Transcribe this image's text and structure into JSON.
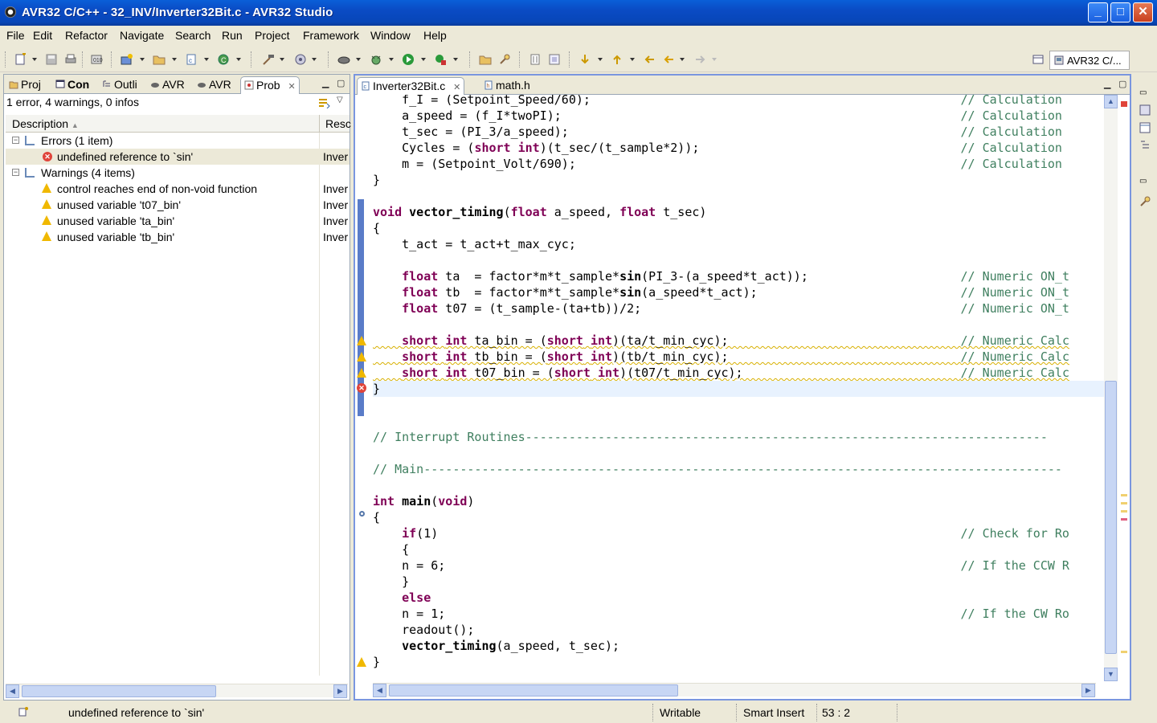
{
  "window": {
    "title": "AVR32 C/C++ - 32_INV/Inverter32Bit.c - AVR32 Studio",
    "min": "_",
    "max": "□",
    "close": "✕"
  },
  "menu": [
    "File",
    "Edit",
    "Refactor",
    "Navigate",
    "Search",
    "Run",
    "Project",
    "Framework",
    "Window",
    "Help"
  ],
  "perspective": "AVR32 C/...",
  "left_tabs": [
    {
      "label": "Proj",
      "icon": "project-explorer-icon"
    },
    {
      "label": "Con",
      "icon": "console-icon"
    },
    {
      "label": "Outli",
      "icon": "outline-icon"
    },
    {
      "label": "AVR",
      "icon": "avr-target-icon"
    },
    {
      "label": "AVR",
      "icon": "avr-target-icon"
    },
    {
      "label": "Prob",
      "icon": "problems-icon"
    }
  ],
  "problems": {
    "summary": "1 error, 4 warnings, 0 infos",
    "col_description": "Description",
    "col_resource": "Resc",
    "groups": [
      {
        "label": "Errors (1 item)",
        "items": [
          {
            "kind": "error",
            "text": "undefined reference to `sin'",
            "resource": "Inver"
          }
        ]
      },
      {
        "label": "Warnings (4 items)",
        "items": [
          {
            "kind": "warning",
            "text": "control reaches end of non-void function",
            "resource": "Inver"
          },
          {
            "kind": "warning",
            "text": "unused variable 't07_bin'",
            "resource": "Inver"
          },
          {
            "kind": "warning",
            "text": "unused variable 'ta_bin'",
            "resource": "Inver"
          },
          {
            "kind": "warning",
            "text": "unused variable 'tb_bin'",
            "resource": "Inver"
          }
        ]
      }
    ]
  },
  "editor_tabs": [
    {
      "label": "Inverter32Bit.c",
      "active": true
    },
    {
      "label": "math.h",
      "active": false
    }
  ],
  "code_lines": [
    "    f_I = (Setpoint_Speed/60);                                                   // Calculation",
    "    a_speed = (f_I*twoPI);                                                       // Calculation",
    "    t_sec = (PI_3/a_speed);                                                      // Calculation",
    "    Cycles = (short int)(t_sec/(t_sample*2));                                    // Calculation",
    "    m = (Setpoint_Volt/690);                                                     // Calculation",
    "}",
    "",
    "void vector_timing(float a_speed, float t_sec)",
    "{",
    "    t_act = t_act+t_max_cyc;",
    "",
    "    float ta  = factor*m*t_sample*sin(PI_3-(a_speed*t_act));                     // Numeric ON_t",
    "    float tb  = factor*m*t_sample*sin(a_speed*t_act);                            // Numeric ON_t",
    "    float t07 = (t_sample-(ta+tb))/2;                                            // Numeric ON_t",
    "",
    "    short int ta_bin = (short int)(ta/t_min_cyc);                                // Numeric Calc",
    "    short int tb_bin = (short int)(tb/t_min_cyc);                                // Numeric Calc",
    "    short int t07_bin = (short int)(t07/t_min_cyc);                              // Numeric Calc",
    "}",
    "",
    "",
    "// Interrupt Routines------------------------------------------------------------------------",
    "",
    "// Main----------------------------------------------------------------------------------------",
    "",
    "int main(void)",
    "{",
    "    if(1)                                                                        // Check for Ro",
    "    {",
    "    n = 6;                                                                       // If the CCW R",
    "    }",
    "    else",
    "    n = 1;                                                                       // If the CW Ro",
    "    readout();",
    "    vector_timing(a_speed, t_sec);",
    "}"
  ],
  "keywords": [
    "void",
    "float",
    "short",
    "int",
    "if",
    "else"
  ],
  "status": {
    "message": "undefined reference to `sin'",
    "writable": "Writable",
    "insert_mode": "Smart Insert",
    "position": "53 : 2"
  },
  "colors": {
    "error": "#e0443a",
    "warning": "#f0b800",
    "keyword": "#7f0055",
    "comment": "#3f7f5f",
    "title_bar": "#0a4bc4"
  }
}
